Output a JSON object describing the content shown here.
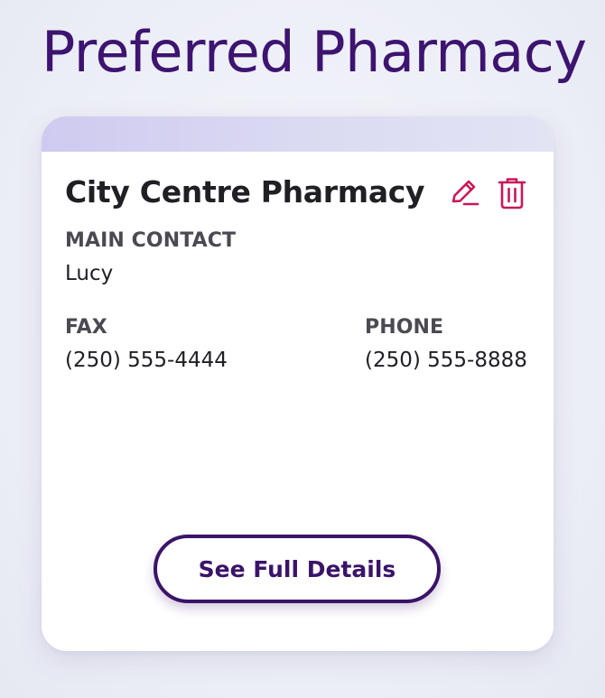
{
  "page": {
    "title": "Preferred Pharmacy"
  },
  "pharmacy": {
    "name": "City Centre Pharmacy",
    "main_contact_label": "MAIN CONTACT",
    "main_contact_value": "Lucy",
    "fax_label": "FAX",
    "fax_value": "(250) 555-4444",
    "phone_label": "PHONE",
    "phone_value": "(250) 555-8888",
    "details_button_label": "See Full Details"
  },
  "icons": {
    "edit": "pencil-icon",
    "delete": "trash-icon"
  },
  "colors": {
    "title": "#3d1470",
    "accent_icon": "#c8185a",
    "button_border": "#3a1468",
    "header_strip": "#d6d2f1"
  }
}
